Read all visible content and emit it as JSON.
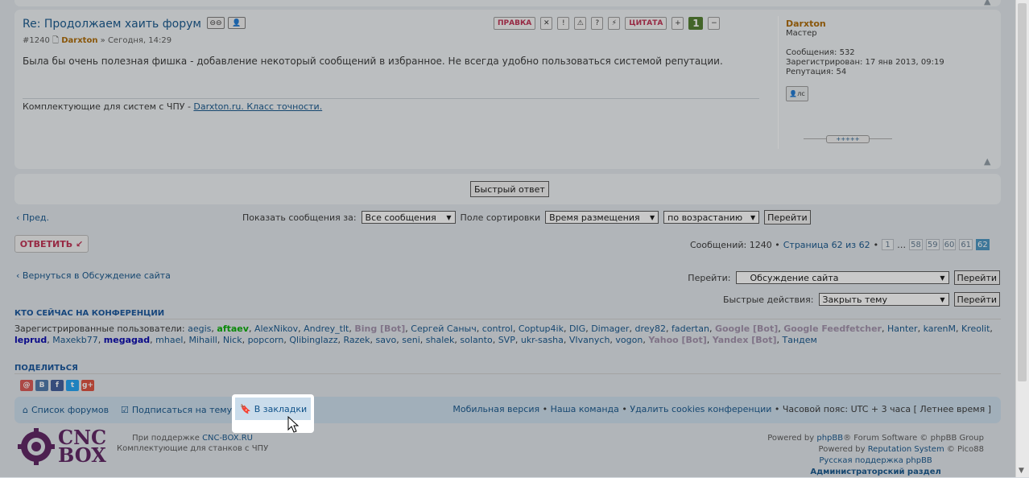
{
  "post": {
    "title": "Re: Продолжаем хаить форум",
    "number": "#1240",
    "author": "Darxton",
    "date": "» Сегодня, 14:29",
    "content": "Была бы очень полезная фишка - добавление некоторый сообщений в избранное. Не всегда удобно пользоваться системой репутации.",
    "signature_prefix": "Комплектующие для систем с ЧПУ - ",
    "signature_link": "Darxton.ru. Класс точности.",
    "edit_label": "ПРАВКА",
    "quote_label": "ЦИТАТА",
    "karma": "1"
  },
  "profile": {
    "name": "Darxton",
    "rank": "Мастер",
    "messages_label": "Сообщения:",
    "messages": "532",
    "registered_label": "Зарегистрирован:",
    "registered": "17 янв 2013, 09:19",
    "reputation_label": "Репутация:",
    "reputation": "54",
    "pm_label": "лс",
    "rep_knob": "+++++"
  },
  "quick_reply_label": "Быстрый ответ",
  "nav": {
    "prev": "Пред.",
    "show_label": "Показать сообщения за:",
    "show_value": "Все сообщения",
    "sort_label": "Поле сортировки",
    "sort_value": "Время размещения",
    "order_value": "по возрастанию",
    "go_label": "Перейти"
  },
  "reply_label": "ОТВЕТИТЬ",
  "pagination": {
    "summary": "Сообщений: 1240 • ",
    "page_text": "Страница 62 из 62",
    "bullet": " • ",
    "pages": [
      "1",
      "…",
      "58",
      "59",
      "60",
      "61",
      "62"
    ],
    "active": "62"
  },
  "back_link": "Вернуться в Обсуждение сайта",
  "jump": {
    "label": "Перейти:",
    "value": "Обсуждение сайта",
    "go": "Перейти"
  },
  "quick_actions": {
    "label": "Быстрые действия:",
    "value": "Закрыть тему",
    "go": "Перейти"
  },
  "online": {
    "heading": "КТО СЕЙЧАС НА КОНФЕРЕНЦИИ",
    "prefix": "Зарегистрированные пользователи: ",
    "users": [
      {
        "n": "aegis",
        "t": "u"
      },
      {
        "n": "aftaev",
        "t": "green"
      },
      {
        "n": "AlexNikov",
        "t": "u"
      },
      {
        "n": "Andrey_tlt",
        "t": "u"
      },
      {
        "n": "Bing [Bot]",
        "t": "bot"
      },
      {
        "n": "Сергей Саныч",
        "t": "u"
      },
      {
        "n": "control",
        "t": "u"
      },
      {
        "n": "Coptup4ik",
        "t": "u"
      },
      {
        "n": "DIG",
        "t": "u"
      },
      {
        "n": "Dimager",
        "t": "u"
      },
      {
        "n": "drey82",
        "t": "u"
      },
      {
        "n": "fadertan",
        "t": "u"
      },
      {
        "n": "Google [Bot]",
        "t": "bot"
      },
      {
        "n": "Google Feedfetcher",
        "t": "bot"
      },
      {
        "n": "Hanter",
        "t": "u"
      },
      {
        "n": "karenM",
        "t": "u"
      },
      {
        "n": "Kreolit",
        "t": "u"
      },
      {
        "n": "leprud",
        "t": "blue"
      },
      {
        "n": "Maxekb77",
        "t": "u"
      },
      {
        "n": "megagad",
        "t": "blue"
      },
      {
        "n": "mhael",
        "t": "u"
      },
      {
        "n": "Mihaill",
        "t": "u"
      },
      {
        "n": "Nick",
        "t": "u"
      },
      {
        "n": "popcorn",
        "t": "u"
      },
      {
        "n": "Qlibinglazz",
        "t": "u"
      },
      {
        "n": "Razek",
        "t": "u"
      },
      {
        "n": "savo",
        "t": "u"
      },
      {
        "n": "seni",
        "t": "u"
      },
      {
        "n": "shalek",
        "t": "u"
      },
      {
        "n": "solanto",
        "t": "u"
      },
      {
        "n": "SVP",
        "t": "u"
      },
      {
        "n": "ukr-sasha",
        "t": "u"
      },
      {
        "n": "VIvanych",
        "t": "u"
      },
      {
        "n": "vogon",
        "t": "u"
      },
      {
        "n": "Yahoo [Bot]",
        "t": "bot"
      },
      {
        "n": "Yandex [Bot]",
        "t": "bot"
      },
      {
        "n": "Тандем",
        "t": "u"
      }
    ]
  },
  "share": {
    "heading": "ПОДЕЛИТЬСЯ",
    "icons": [
      {
        "name": "mail-ru-icon",
        "glyph": "@",
        "color": "#d9534f"
      },
      {
        "name": "vkontakte-icon",
        "glyph": "B",
        "color": "#4a76a8"
      },
      {
        "name": "facebook-icon",
        "glyph": "f",
        "color": "#3b5998"
      },
      {
        "name": "twitter-icon",
        "glyph": "t",
        "color": "#1da1f2"
      },
      {
        "name": "google-plus-icon",
        "glyph": "g+",
        "color": "#dd4b39"
      }
    ]
  },
  "navbar": {
    "forum_list": "Список форумов",
    "subscribe": "Подписаться на тему",
    "bookmark": "В закладки",
    "mobile": "Мобильная версия",
    "team": "Наша команда",
    "delete_cookies": "Удалить cookies конференции",
    "bullet": " • ",
    "timezone": "Часовой пояс: UTC + 3 часа [ Летнее время ]"
  },
  "footer": {
    "logo_line1": "CNC",
    "logo_line2": "BOX",
    "support_prefix": "При поддержке ",
    "support_link": "CNC-BOX.RU",
    "support_line2": "Комплектующие для станков с ЧПУ",
    "powered_prefix": "Powered by ",
    "phpbb": "phpBB",
    "powered_suffix": "® Forum Software © phpBB Group",
    "rep_prefix": "Powered by ",
    "rep_link": "Reputation System",
    "rep_suffix": " © Pico88",
    "russian": "Русская поддержка phpBB",
    "admin": "Администраторский раздел"
  }
}
